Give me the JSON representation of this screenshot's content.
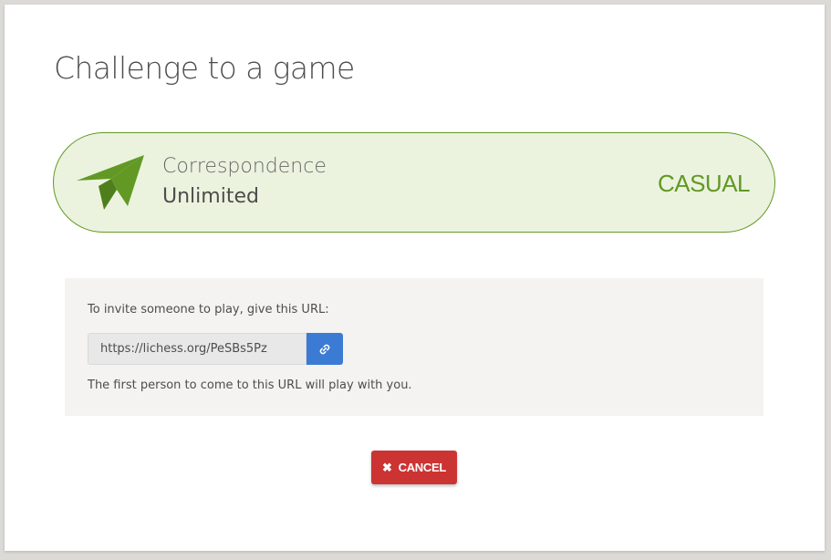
{
  "header": {
    "title": "Challenge to a game"
  },
  "game": {
    "speed": "Correspondence",
    "clock": "Unlimited",
    "mode": "CASUAL",
    "icon": "paper-plane-icon"
  },
  "invite": {
    "instruction": "To invite someone to play, give this URL:",
    "url": "https://lichess.org/PeSBs5Pz",
    "copy_icon": "link-icon",
    "note": "The first person to come to this URL will play with you."
  },
  "actions": {
    "cancel_label": "CANCEL",
    "cancel_icon": "close-icon"
  },
  "colors": {
    "accent": "#629924",
    "accent_bg": "#ebf3df",
    "copy_button": "#3b7bd3",
    "cancel_button": "#cc3333"
  }
}
